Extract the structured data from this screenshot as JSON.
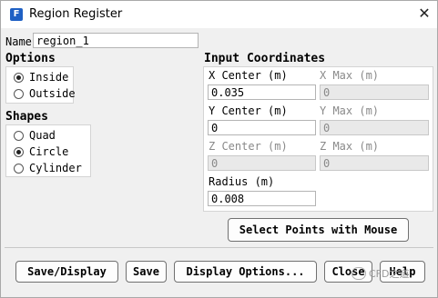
{
  "window": {
    "title": "Region Register",
    "app_icon_letter": "F"
  },
  "name": {
    "label": "Name",
    "value": "region_1"
  },
  "options": {
    "heading": "Options",
    "items": [
      {
        "label": "Inside",
        "checked": true
      },
      {
        "label": "Outside",
        "checked": false
      }
    ]
  },
  "shapes": {
    "heading": "Shapes",
    "items": [
      {
        "label": "Quad",
        "checked": false
      },
      {
        "label": "Circle",
        "checked": true
      },
      {
        "label": "Cylinder",
        "checked": false
      }
    ]
  },
  "input_coordinates": {
    "heading": "Input Coordinates",
    "x_center": {
      "label": "X Center (m)",
      "value": "0.035",
      "enabled": true
    },
    "x_max": {
      "label": "X Max (m)",
      "value": "0",
      "enabled": false
    },
    "y_center": {
      "label": "Y Center (m)",
      "value": "0",
      "enabled": true
    },
    "y_max": {
      "label": "Y Max (m)",
      "value": "0",
      "enabled": false
    },
    "z_center": {
      "label": "Z Center (m)",
      "value": "0",
      "enabled": false
    },
    "z_max": {
      "label": "Z Max (m)",
      "value": "0",
      "enabled": false
    },
    "radius": {
      "label": "Radius (m)",
      "value": "0.008",
      "enabled": true
    }
  },
  "select_points_button": "Select Points with Mouse",
  "footer": {
    "save_display": "Save/Display",
    "save": "Save",
    "display_options": "Display Options...",
    "close": "Close",
    "help": "Help"
  },
  "watermark": "CFD之道"
}
